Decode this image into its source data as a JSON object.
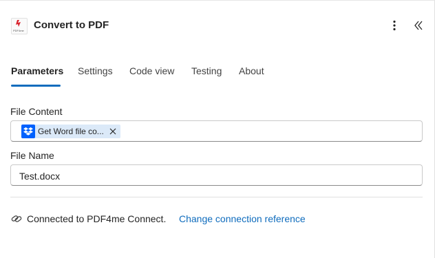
{
  "header": {
    "title": "Convert to PDF",
    "logo_caption": "PDF4me",
    "logo_icon": "pdf4me-logo-icon",
    "more_icon": "more-vertical-icon",
    "collapse_icon": "chevron-double-left-icon"
  },
  "tabs": [
    {
      "label": "Parameters",
      "active": true
    },
    {
      "label": "Settings",
      "active": false
    },
    {
      "label": "Code view",
      "active": false
    },
    {
      "label": "Testing",
      "active": false
    },
    {
      "label": "About",
      "active": false
    }
  ],
  "fields": {
    "file_content": {
      "label": "File Content",
      "token": {
        "icon": "dropbox-icon",
        "text": "Get Word file co..."
      }
    },
    "file_name": {
      "label": "File Name",
      "value": "Test.docx"
    }
  },
  "connection": {
    "icon": "link-icon",
    "text": "Connected to PDF4me Connect.",
    "change_link": "Change connection reference"
  },
  "colors": {
    "accent": "#0f6cbd",
    "token_bg": "#dbe9f8",
    "dropbox": "#0061fe"
  }
}
